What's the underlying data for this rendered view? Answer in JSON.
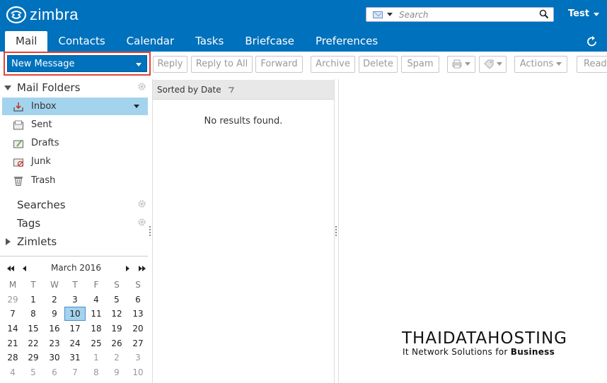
{
  "brand": {
    "name": "zimbra"
  },
  "search": {
    "placeholder": "Search"
  },
  "user": {
    "name": "Test"
  },
  "tabs": [
    {
      "label": "Mail"
    },
    {
      "label": "Contacts"
    },
    {
      "label": "Calendar"
    },
    {
      "label": "Tasks"
    },
    {
      "label": "Briefcase"
    },
    {
      "label": "Preferences"
    }
  ],
  "toolbar": {
    "new_message": "New Message",
    "reply": "Reply",
    "reply_all": "Reply to All",
    "forward": "Forward",
    "archive": "Archive",
    "delete": "Delete",
    "spam": "Spam",
    "actions": "Actions",
    "read": "Read"
  },
  "sidebar": {
    "mail_folders": "Mail Folders",
    "folders": [
      {
        "label": "Inbox"
      },
      {
        "label": "Sent"
      },
      {
        "label": "Drafts"
      },
      {
        "label": "Junk"
      },
      {
        "label": "Trash"
      }
    ],
    "searches": "Searches",
    "tags": "Tags",
    "zimlets": "Zimlets"
  },
  "calendar": {
    "month_label": "March 2016",
    "weekdays": [
      "M",
      "T",
      "W",
      "T",
      "F",
      "S",
      "S"
    ],
    "weeks": [
      [
        "29",
        "1",
        "2",
        "3",
        "4",
        "5",
        "6"
      ],
      [
        "7",
        "8",
        "9",
        "10",
        "11",
        "12",
        "13"
      ],
      [
        "14",
        "15",
        "16",
        "17",
        "18",
        "19",
        "20"
      ],
      [
        "21",
        "22",
        "23",
        "24",
        "25",
        "26",
        "27"
      ],
      [
        "28",
        "29",
        "30",
        "31",
        "1",
        "2",
        "3"
      ],
      [
        "4",
        "5",
        "6",
        "7",
        "8",
        "9",
        "10"
      ]
    ],
    "today": "10"
  },
  "list": {
    "sort_label": "Sorted by Date",
    "empty_message": "No results found."
  },
  "watermark": {
    "title": "THAIDATAHOSTING",
    "subtitle_a": "It Network Solutions for ",
    "subtitle_b": "Business"
  },
  "colors": {
    "accent": "#0071bc",
    "selected": "#a4d3ee",
    "highlight_border": "#e2433b"
  }
}
